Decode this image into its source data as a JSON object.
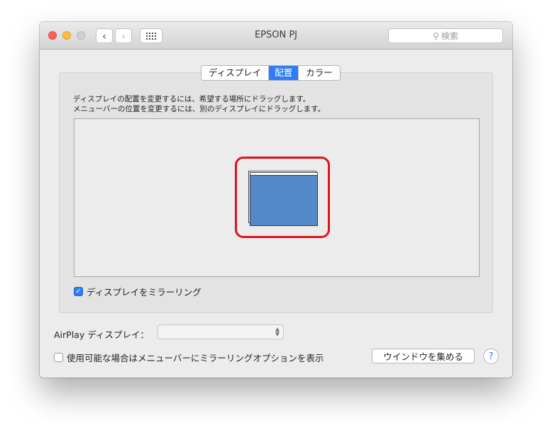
{
  "window": {
    "title": "EPSON PJ",
    "nav_back_icon": "‹",
    "nav_forward_icon": "›"
  },
  "search": {
    "icon": "search-icon",
    "icon_glyph": "⚲",
    "placeholder": "検索"
  },
  "tabs": [
    {
      "label": "ディスプレイ",
      "active": false
    },
    {
      "label": "配置",
      "active": true
    },
    {
      "label": "カラー",
      "active": false
    }
  ],
  "arrangement": {
    "instruction_line1": "ディスプレイの配置を変更するには、希望する場所にドラッグします。",
    "instruction_line2": "メニューバーの位置を変更するには、別のディスプレイにドラッグします。",
    "display_color": "#5388c9",
    "highlight_color": "#e0131d"
  },
  "mirror": {
    "label": "ディスプレイをミラーリング",
    "checked": true,
    "check_glyph": "✓"
  },
  "airplay": {
    "label": "AirPlay ディスプレイ：",
    "value": "",
    "arrows": "⌃⌄"
  },
  "menu_option": {
    "label": "使用可能な場合はメニューバーにミラーリングオプションを表示",
    "checked": false
  },
  "buttons": {
    "gather_windows": "ウインドウを集める",
    "help": "?"
  },
  "colors": {
    "accent": "#2f7df6",
    "close": "#fc605c",
    "minimize": "#fdbc40",
    "zoom_disabled": "#d0d0d0"
  }
}
